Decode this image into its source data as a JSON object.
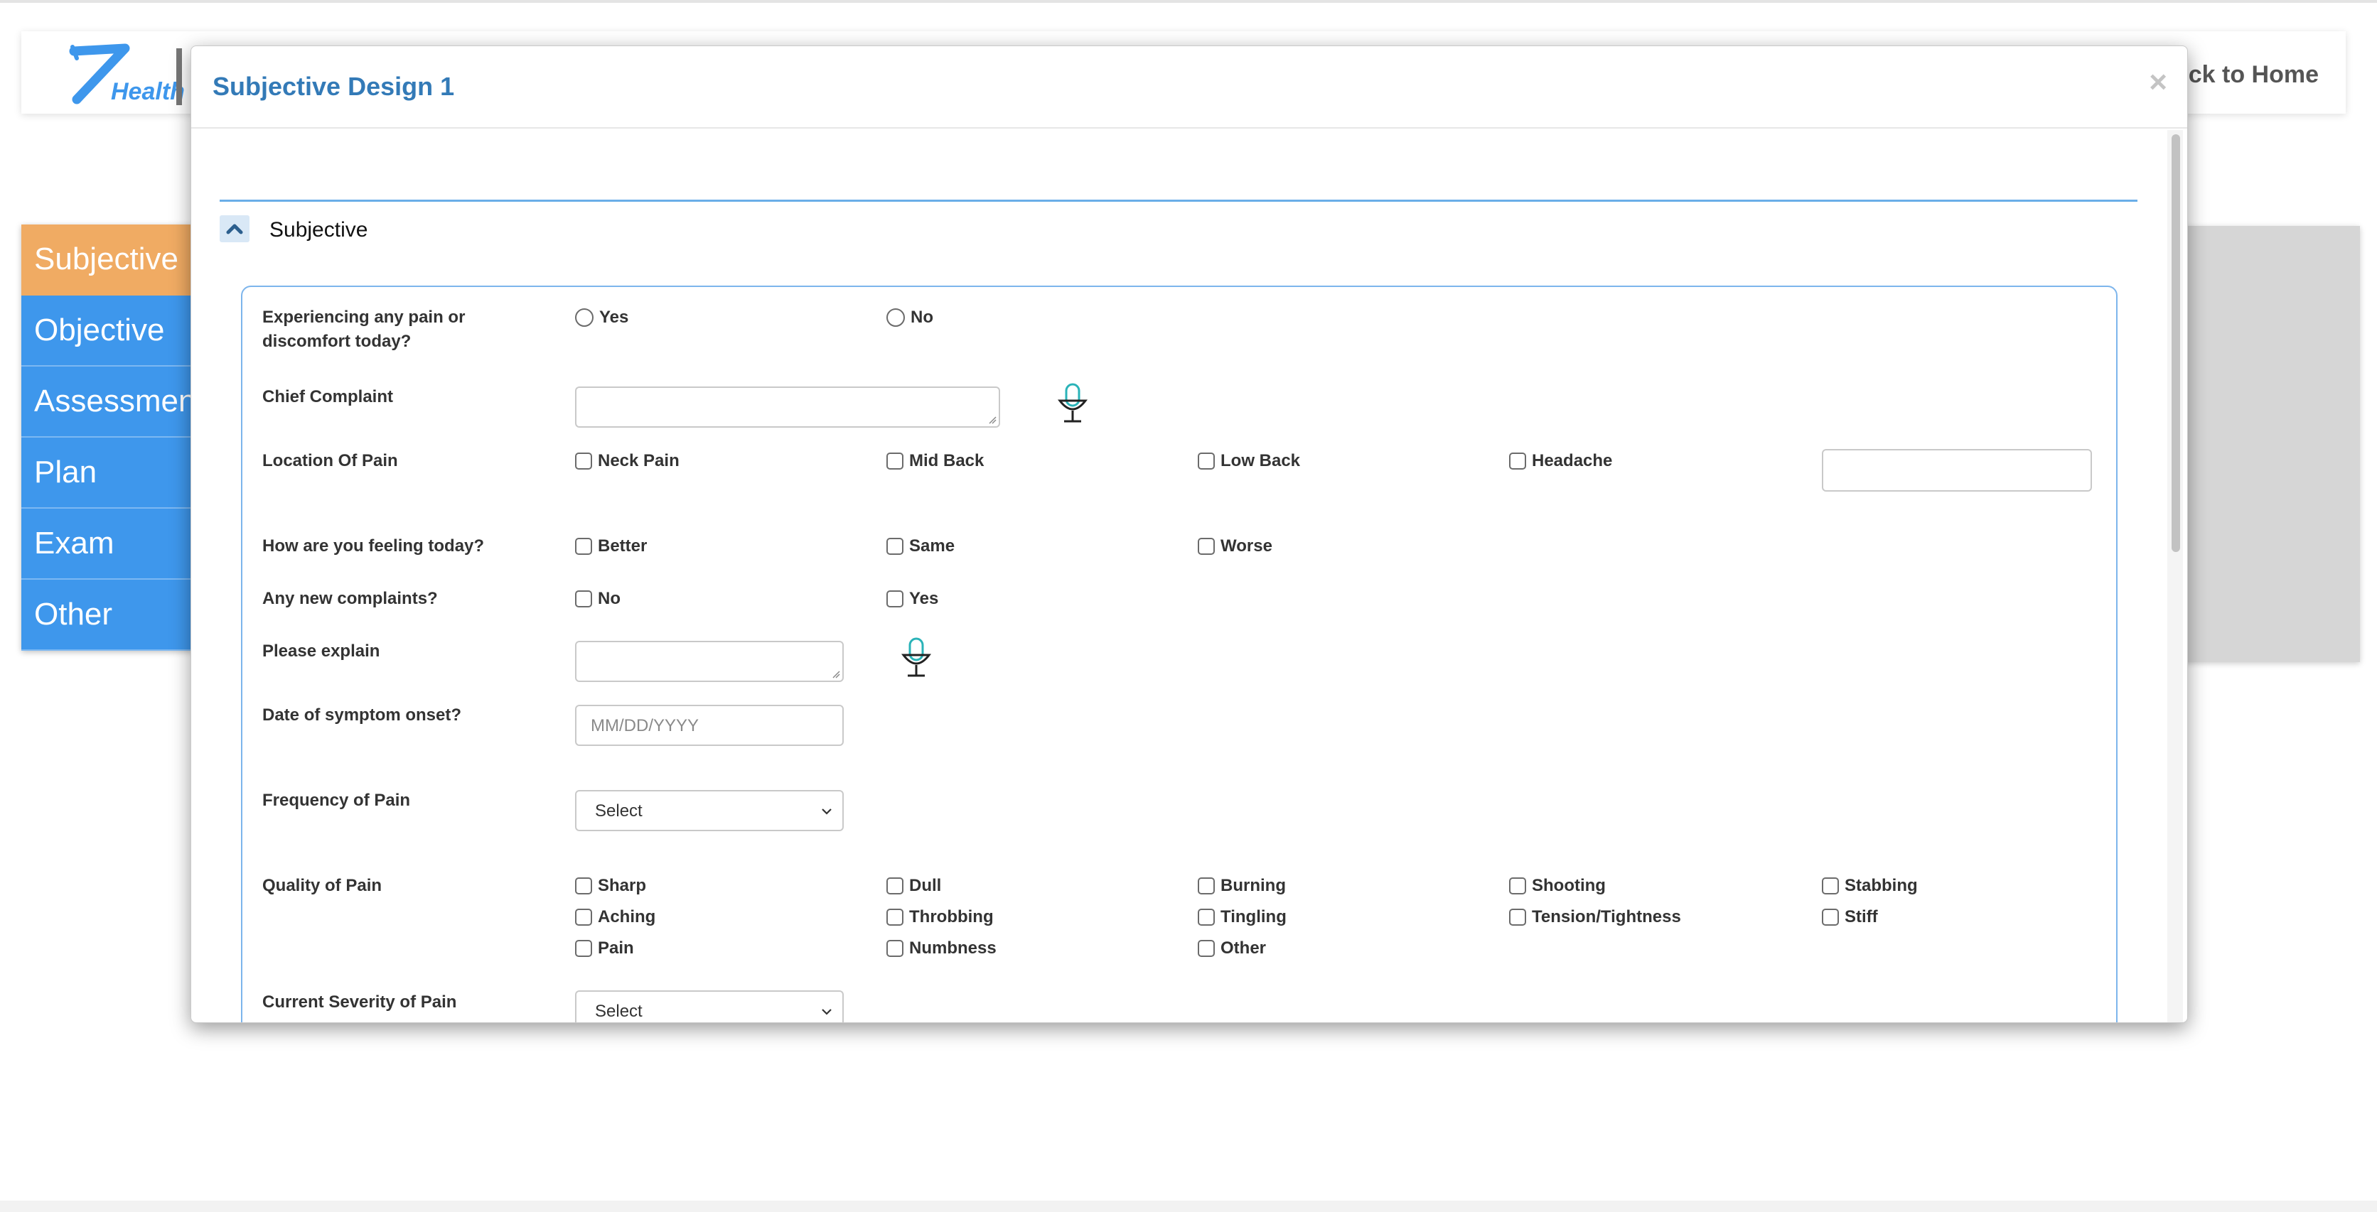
{
  "header": {
    "logo_text": "Health",
    "back_home_label": "ck to Home"
  },
  "sidebar": {
    "items": [
      {
        "label": "Subjective",
        "active": true
      },
      {
        "label": "Objective"
      },
      {
        "label": "Assessment"
      },
      {
        "label": "Plan"
      },
      {
        "label": "Exam"
      },
      {
        "label": "Other"
      }
    ]
  },
  "modal": {
    "title": "Subjective Design 1",
    "close_label": "×",
    "section_title": "Subjective"
  },
  "form": {
    "pain_today": {
      "label": "Experiencing any pain or discomfort today?",
      "options": [
        "Yes",
        "No"
      ]
    },
    "chief_complaint": {
      "label": "Chief Complaint",
      "value": ""
    },
    "location": {
      "label": "Location Of Pain",
      "options": [
        "Neck Pain",
        "Mid Back",
        "Low Back",
        "Headache"
      ],
      "other_value": ""
    },
    "feeling": {
      "label": "How are you feeling today?",
      "options": [
        "Better",
        "Same",
        "Worse"
      ]
    },
    "new_complaints": {
      "label": "Any new complaints?",
      "options": [
        "No",
        "Yes"
      ]
    },
    "explain": {
      "label": "Please explain",
      "value": ""
    },
    "onset": {
      "label": "Date of symptom onset?",
      "placeholder": "MM/DD/YYYY"
    },
    "frequency": {
      "label": "Frequency of Pain",
      "selected": "Select"
    },
    "quality": {
      "label": "Quality of Pain",
      "options": [
        "Sharp",
        "Dull",
        "Burning",
        "Shooting",
        "Stabbing",
        "Aching",
        "Throbbing",
        "Tingling",
        "Tension/Tightness",
        "Stiff",
        "Pain",
        "Numbness",
        "Other"
      ]
    },
    "severity": {
      "label": "Current Severity of Pain",
      "selected": "Select"
    }
  },
  "colors": {
    "nav_blue": "#3e97ec",
    "nav_active": "#f0ab63",
    "title_blue": "#337ab7",
    "border_blue": "#7db5ec",
    "mic_teal": "#2ab3b8"
  },
  "icons": [
    "logo-z-icon",
    "chevron-up-icon",
    "microphone-icon",
    "chevron-down-icon",
    "close-icon"
  ]
}
